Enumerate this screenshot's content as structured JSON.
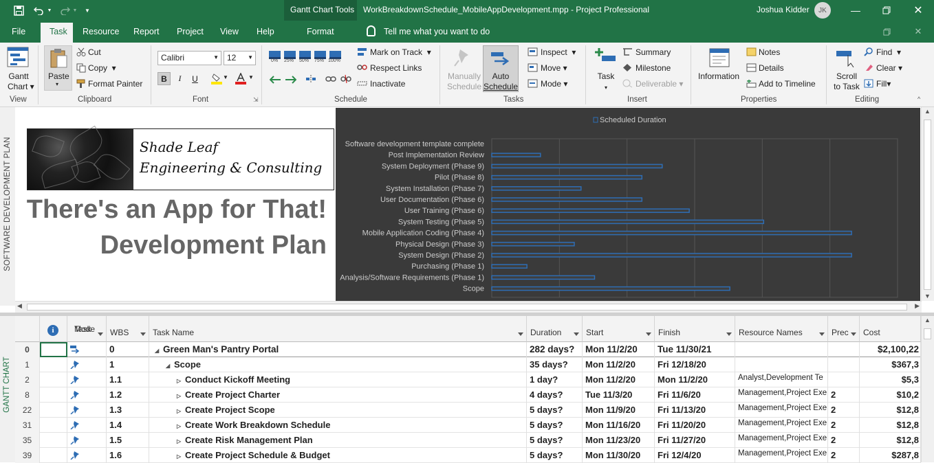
{
  "titlebar": {
    "tools_context": "Gantt Chart Tools",
    "document": "WorkBreakdownSchedule_MobileAppDevelopment.mpp  -  Project Professional",
    "user": "Joshua Kidder",
    "initials": "JK",
    "brand_color": "#217346"
  },
  "menu": {
    "file": "File",
    "task": "Task",
    "resource": "Resource",
    "report": "Report",
    "project": "Project",
    "view": "View",
    "help": "Help",
    "format": "Format",
    "tell_me": "Tell me what you want to do"
  },
  "ribbon": {
    "view": {
      "gantt_line1": "Gantt",
      "gantt_line2": "Chart",
      "label": "View"
    },
    "clipboard": {
      "paste": "Paste",
      "cut": "Cut",
      "copy": "Copy",
      "format_painter": "Format Painter",
      "label": "Clipboard"
    },
    "font": {
      "family": "Calibri",
      "size": "12",
      "bold": "B",
      "italic": "I",
      "underline": "U",
      "label": "Font"
    },
    "schedule": {
      "pct": [
        "0%",
        "25%",
        "50%",
        "75%",
        "100%"
      ],
      "mark_on_track": "Mark on Track",
      "respect_links": "Respect Links",
      "inactivate": "Inactivate",
      "label": "Schedule"
    },
    "tasks": {
      "manually_1": "Manually",
      "manually_2": "Schedule",
      "auto_1": "Auto",
      "auto_2": "Schedule",
      "inspect": "Inspect",
      "move": "Move",
      "mode": "Mode",
      "label": "Tasks"
    },
    "insert": {
      "task": "Task",
      "summary": "Summary",
      "milestone": "Milestone",
      "deliverable": "Deliverable",
      "label": "Insert"
    },
    "properties": {
      "information": "Information",
      "notes": "Notes",
      "details": "Details",
      "add_to_timeline": "Add to Timeline",
      "label": "Properties"
    },
    "editing": {
      "scroll_1": "Scroll",
      "scroll_2": "to Task",
      "find": "Find",
      "clear": "Clear",
      "fill": "Fill",
      "label": "Editing"
    }
  },
  "timeline": {
    "side_label": "SOFTWARE DEVELOPMENT PLAN",
    "logo_line1": "Shade Leaf",
    "logo_line2": "Engineering & Consulting",
    "title_line1": "There's an App for That!",
    "title_line2": "Development Plan"
  },
  "chart_data": {
    "type": "bar",
    "orientation": "horizontal",
    "legend": "Scheduled Duration",
    "legend_position": "top-center",
    "grid": true,
    "bar_color": "#2e6db4",
    "xlim": [
      0,
      600
    ],
    "categories": [
      "Software development template complete",
      "Post Implementation Review",
      "System Deployment (Phase 9)",
      "Pilot (Phase 8)",
      "System Installation (Phase 7)",
      "User Documentation (Phase 6)",
      "User Training (Phase 6)",
      "System Testing (Phase 5)",
      "Mobile Application Coding (Phase 4)",
      "Physical Design (Phase 3)",
      "System Design (Phase 2)",
      "Purchasing (Phase 1)",
      "Analysis/Software Requirements (Phase 1)",
      "Scope"
    ],
    "series": [
      {
        "name": "Scheduled Duration",
        "values": [
          0,
          72,
          252,
          222,
          132,
          222,
          292,
          402,
          532,
          122,
          532,
          52,
          152,
          352
        ]
      }
    ]
  },
  "grid": {
    "side_label": "GANTT CHART",
    "headers": {
      "info": "i",
      "mode_1": "Task",
      "mode_2": "Mode",
      "wbs": "WBS",
      "name": "Task Name",
      "duration": "Duration",
      "start": "Start",
      "finish": "Finish",
      "resources": "Resource Names",
      "pred": "Prec",
      "cost": "Cost"
    },
    "rows": [
      {
        "id": "0",
        "wbs": "0",
        "name": "Green Man's Pantry Portal",
        "duration": "282 days?",
        "start": "Mon 11/2/20",
        "finish": "Tue 11/30/21",
        "resources": "",
        "pred": "",
        "cost": "$2,100,22"
      },
      {
        "id": "1",
        "wbs": "1",
        "name": "Scope",
        "duration": "35 days?",
        "start": "Mon 11/2/20",
        "finish": "Fri 12/18/20",
        "resources": "",
        "pred": "",
        "cost": "$367,3"
      },
      {
        "id": "2",
        "wbs": "1.1",
        "name": "Conduct Kickoff Meeting",
        "duration": "1 day?",
        "start": "Mon 11/2/20",
        "finish": "Mon 11/2/20",
        "resources": "Analyst,Development Te",
        "pred": "",
        "cost": "$5,3"
      },
      {
        "id": "8",
        "wbs": "1.2",
        "name": "Create Project Charter",
        "duration": "4 days?",
        "start": "Tue 11/3/20",
        "finish": "Fri 11/6/20",
        "resources": "Management,Project Exe",
        "pred": "2",
        "cost": "$10,2"
      },
      {
        "id": "22",
        "wbs": "1.3",
        "name": "Create Project Scope",
        "duration": "5 days?",
        "start": "Mon 11/9/20",
        "finish": "Fri 11/13/20",
        "resources": "Management,Project Exe",
        "pred": "2",
        "cost": "$12,8"
      },
      {
        "id": "31",
        "wbs": "1.4",
        "name": "Create Work Breakdown Schedule",
        "duration": "5 days?",
        "start": "Mon 11/16/20",
        "finish": "Fri 11/20/20",
        "resources": "Management,Project Exe",
        "pred": "2",
        "cost": "$12,8"
      },
      {
        "id": "35",
        "wbs": "1.5",
        "name": "Create Risk Management Plan",
        "duration": "5 days?",
        "start": "Mon 11/23/20",
        "finish": "Fri 11/27/20",
        "resources": "Management,Project Exe",
        "pred": "2",
        "cost": "$12,8"
      },
      {
        "id": "39",
        "wbs": "1.6",
        "name": "Create Project Schedule & Budget",
        "duration": "5 days?",
        "start": "Mon 11/30/20",
        "finish": "Fri 12/4/20",
        "resources": "Management,Project Exe",
        "pred": "2",
        "cost": "$287,8"
      }
    ]
  }
}
